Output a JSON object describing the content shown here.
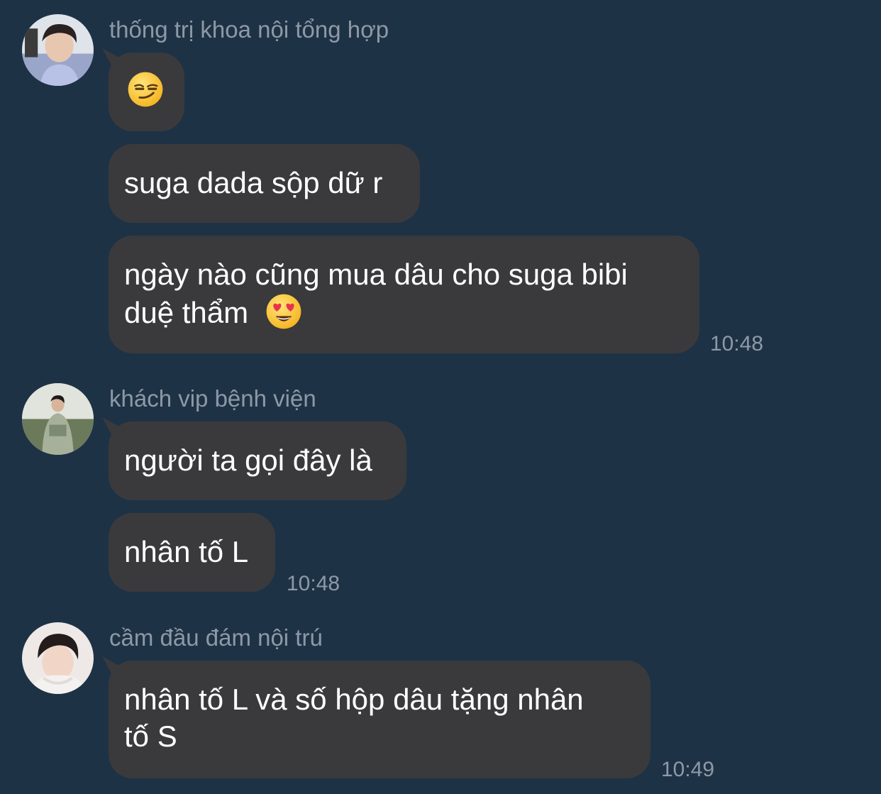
{
  "messages_group_1": {
    "sender": "thống trị khoa nội tổng hợp",
    "msg_2": "suga dada sộp dữ r",
    "msg_3_line1": "ngày nào cũng mua dâu cho suga bibi",
    "msg_3_line2": "duệ thẩm",
    "time": "10:48",
    "emoji_1": "smirking-face-emoji",
    "emoji_2": "heart-eyes-emoji"
  },
  "messages_group_2": {
    "sender": "khách vip bệnh viện",
    "msg_1": "người ta gọi đây là",
    "msg_2": "nhân tố L",
    "time": "10:48"
  },
  "messages_group_3": {
    "sender": "cầm đầu đám nội trú",
    "msg_1_line1": "nhân tố L và số hộp dâu tặng nhân",
    "msg_1_line2": "tố S",
    "time": "10:49"
  },
  "colors": {
    "background": "#1e3246",
    "bubble": "#3a3a3c",
    "meta_text": "#8e99a6"
  }
}
